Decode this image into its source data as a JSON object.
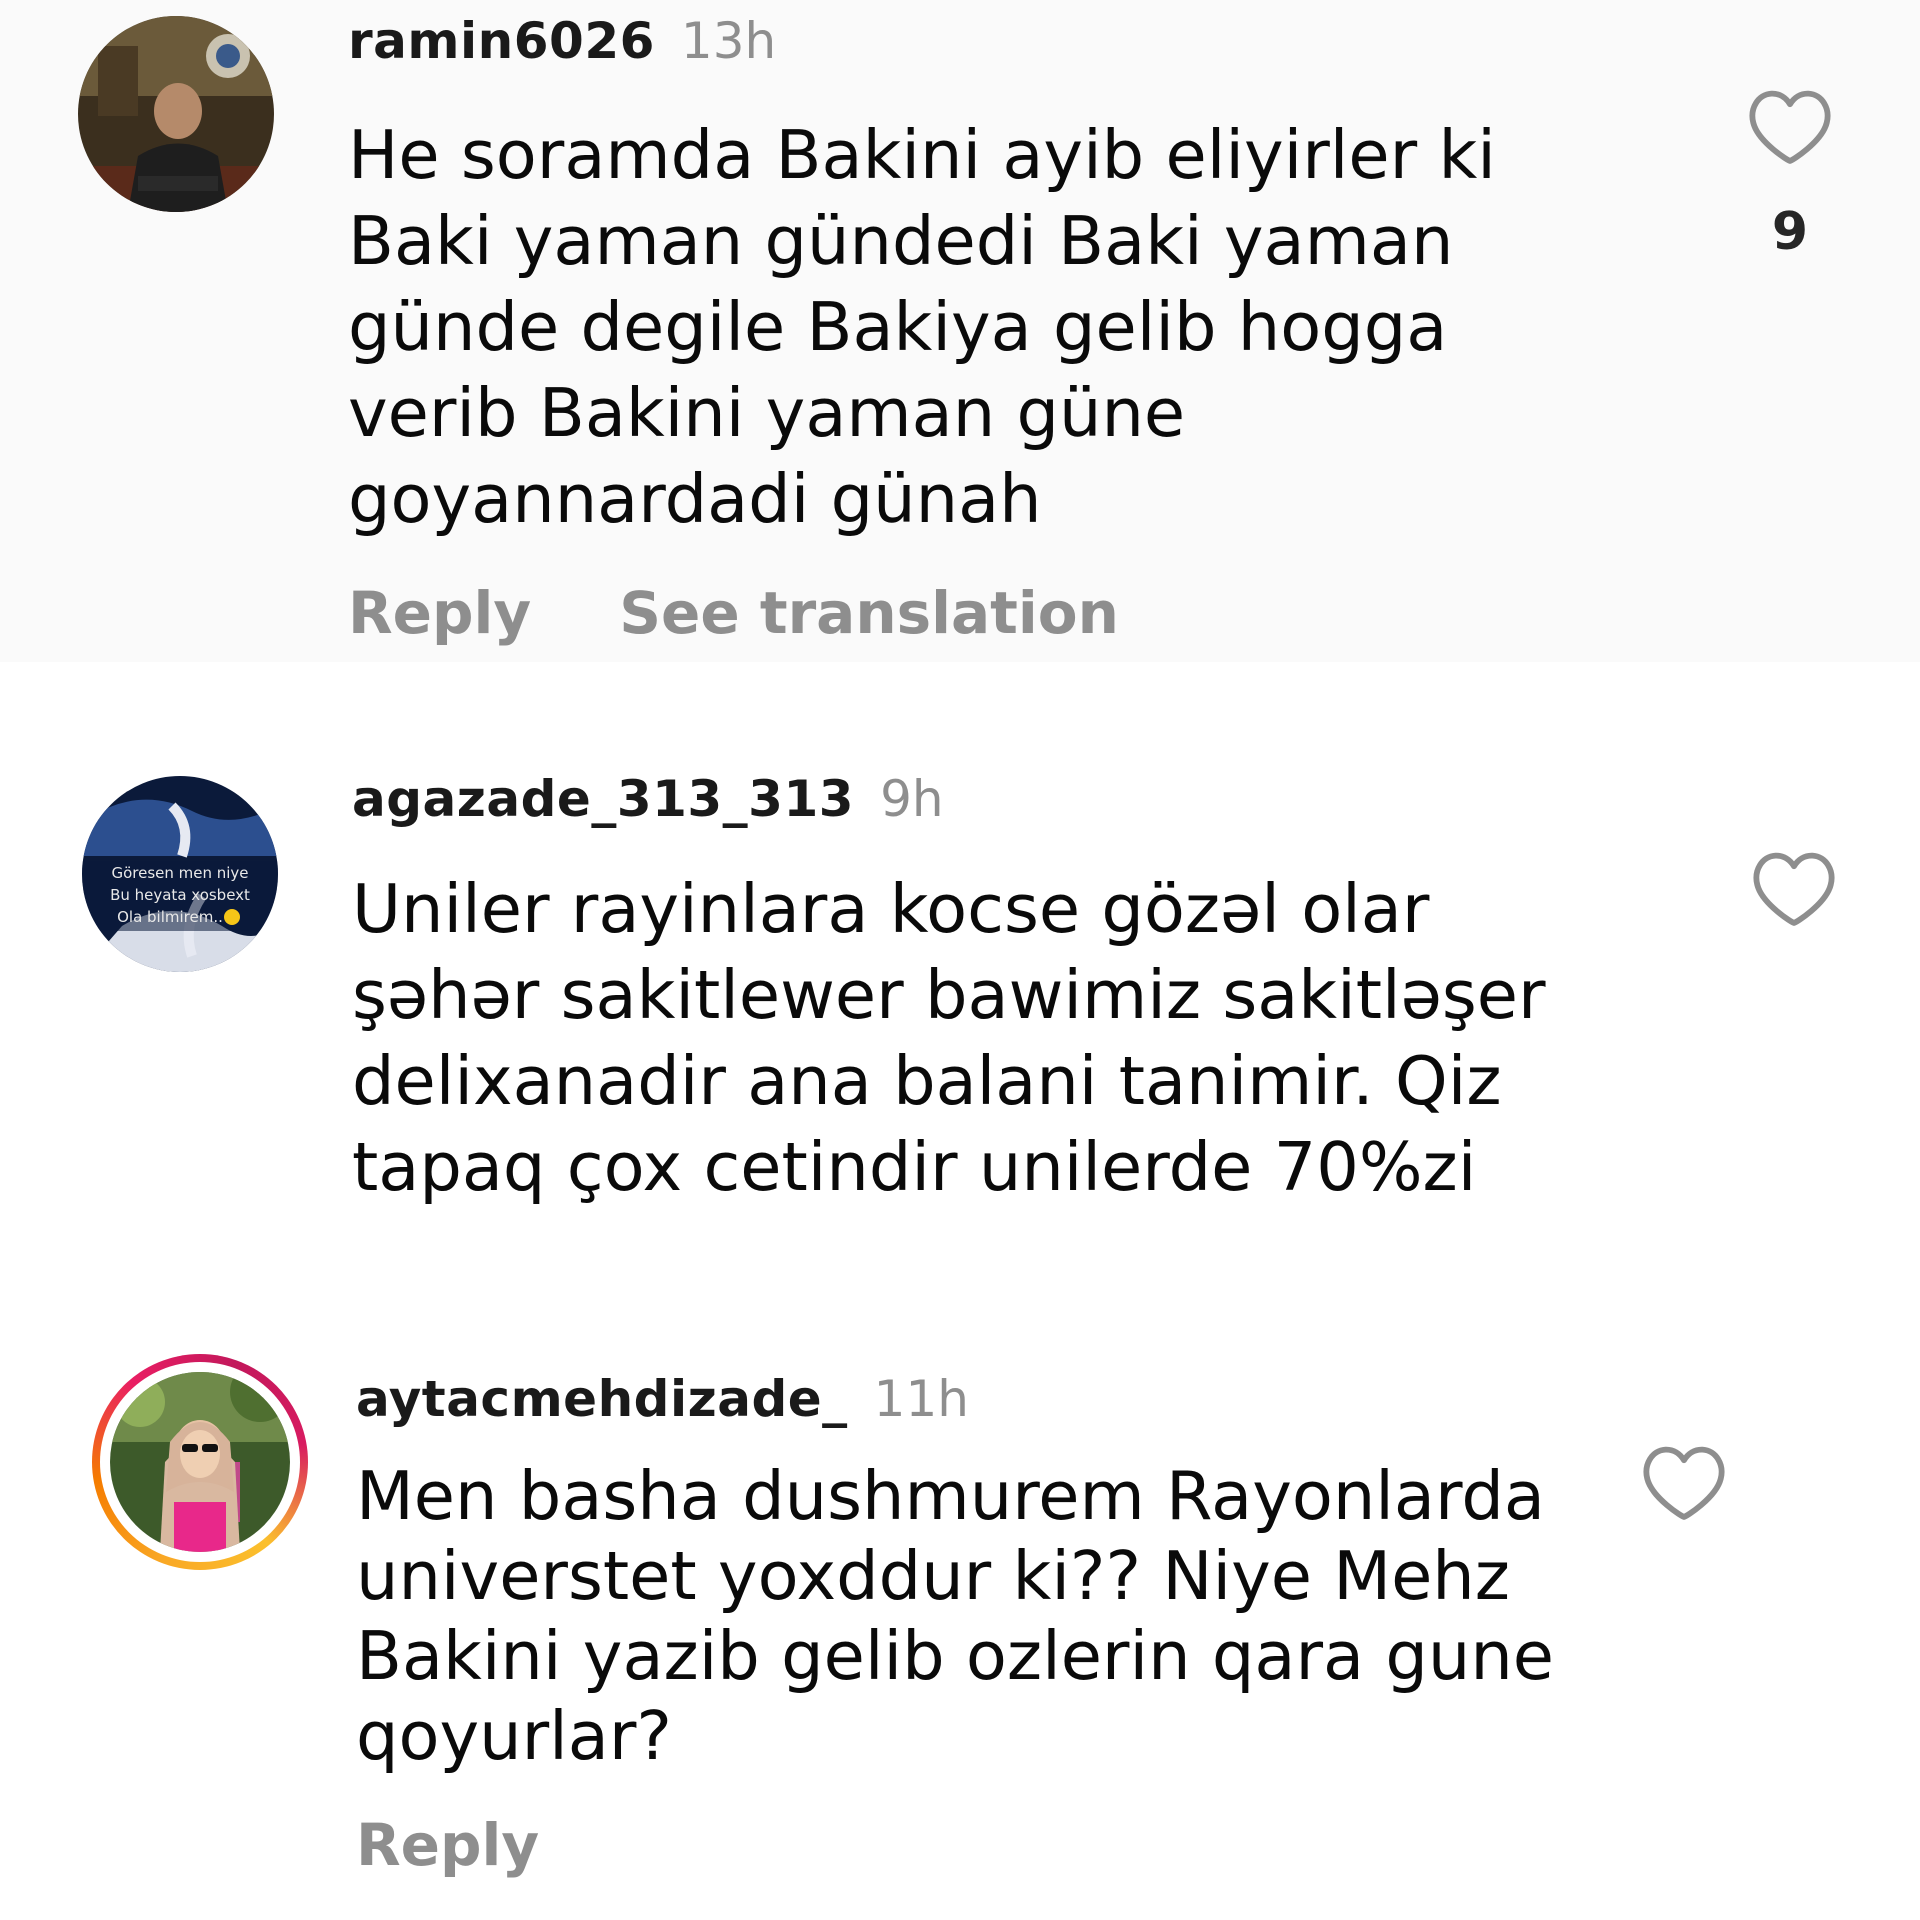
{
  "comments": [
    {
      "username": "ramin6026",
      "time": "13h",
      "lines": [
        "He soramda Bakini ayib eliyirler ki",
        "Baki yaman gündedi Baki yaman",
        "günde degile Bakiya gelib hogga",
        "verib Bakini yaman güne",
        "goyannardadi günah"
      ],
      "reply_label": "Reply",
      "translate_label": "See translation",
      "like_count": "9"
    },
    {
      "username": "agazade_313_313",
      "time": "9h",
      "avatar_lines": [
        "Göresen men niye",
        "Bu heyata xosbext",
        "Ola bilmirem.."
      ],
      "lines": [
        "Uniler rayinlara kocse gözəl olar",
        "şəhər sakitlewer bawimiz sakitləşer",
        "delixanadir ana balani tanimir. Qiz",
        "tapaq çox cetindir unilerde 70%zi"
      ]
    },
    {
      "username": "aytacmehdizade_",
      "time": "11h",
      "lines": [
        "Men basha dushmurem Rayonlarda",
        "universtet yoxddur ki?? Niye Mehz",
        "Bakini yazib gelib ozlerin qara gune",
        "qoyurlar?"
      ],
      "reply_label": "Reply"
    }
  ],
  "icons": {
    "like": "heart-outline-icon"
  },
  "colors": {
    "meta_gray": "#8e8e8e",
    "text": "#0a0a0a",
    "highlight_bg": "#fafafa"
  }
}
